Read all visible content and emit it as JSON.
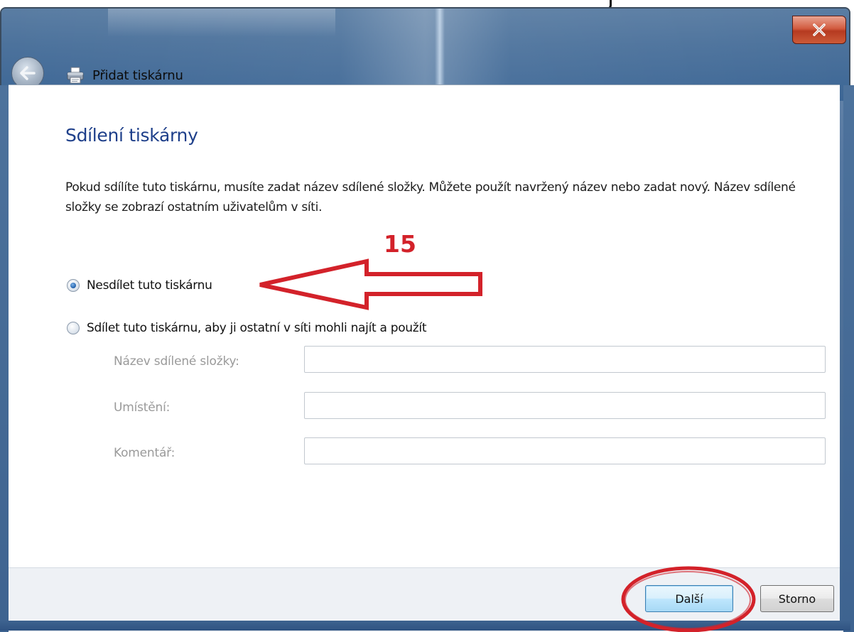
{
  "window": {
    "title": "Přidat tiskárnu",
    "close_glyph": "x"
  },
  "page": {
    "heading": "Sdílení tiskárny",
    "description": "Pokud sdílíte tuto tiskárnu, musíte zadat název sdílené složky. Můžete použít navržený název nebo zadat nový. Název sdílené složky se zobrazí ostatním uživatelům v síti."
  },
  "options": [
    {
      "label": "Nesdílet tuto tiskárnu",
      "selected": true
    },
    {
      "label": "Sdílet tuto tiskárnu, aby ji ostatní v síti mohli najít a použít",
      "selected": false
    }
  ],
  "fields": [
    {
      "label": "Název sdílené složky:",
      "value": ""
    },
    {
      "label": "Umístění:",
      "value": ""
    },
    {
      "label": "Komentář:",
      "value": ""
    }
  ],
  "buttons": {
    "next": "Další",
    "cancel": "Storno"
  },
  "annotation": {
    "step_number": "15",
    "color": "#d3222a"
  },
  "icons": [
    "back-arrow-icon",
    "printer-icon",
    "close-icon",
    "radio-selected-icon",
    "radio-unselected-icon"
  ]
}
